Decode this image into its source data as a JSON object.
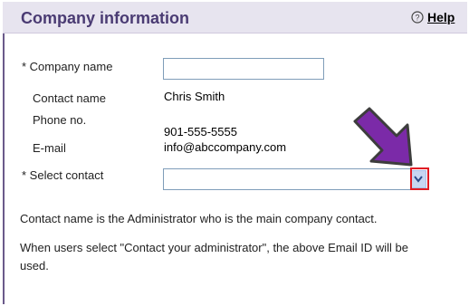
{
  "header": {
    "title": "Company information",
    "help_label": "Help"
  },
  "form": {
    "company_name_label": "* Company name",
    "company_name_value": "",
    "contact_name_label": "Contact name",
    "contact_name_value": "Chris Smith",
    "phone_label": "Phone no.",
    "phone_value": "901-555-5555",
    "email_label": "E-mail",
    "email_value": "info@abccompany.com",
    "select_contact_label": "* Select contact",
    "select_contact_value": ""
  },
  "notes": {
    "line1": "Contact name is the Administrator who is the main company contact.",
    "line2": "When users select \"Contact your administrator\", the above Email ID will be used."
  },
  "colors": {
    "header_bg": "#e7e4ef",
    "title_color": "#4a3b73",
    "arrow_color": "#7b2aa8",
    "highlight_border": "#e01b24"
  },
  "icons": {
    "help": "question-circle-icon",
    "dropdown": "chevron-down-icon",
    "annotation": "arrow-pointer-icon"
  }
}
